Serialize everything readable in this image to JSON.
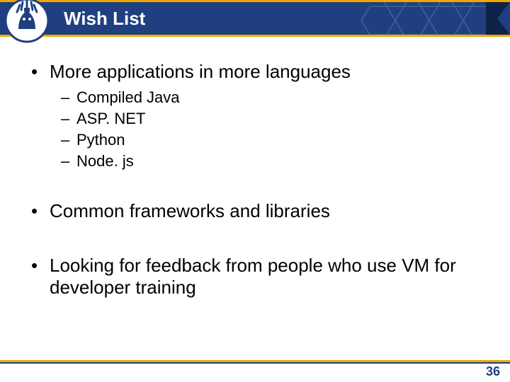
{
  "header": {
    "title": "Wish List"
  },
  "content": {
    "bullets": [
      {
        "text": "More applications in more languages",
        "sub": [
          "Compiled Java",
          "ASP. NET",
          "Python",
          "Node. js"
        ]
      },
      {
        "text": "Common frameworks and libraries",
        "sub": []
      },
      {
        "text": "Looking for feedback from people who use VM for developer training",
        "sub": []
      }
    ]
  },
  "footer": {
    "page_number": "36"
  }
}
